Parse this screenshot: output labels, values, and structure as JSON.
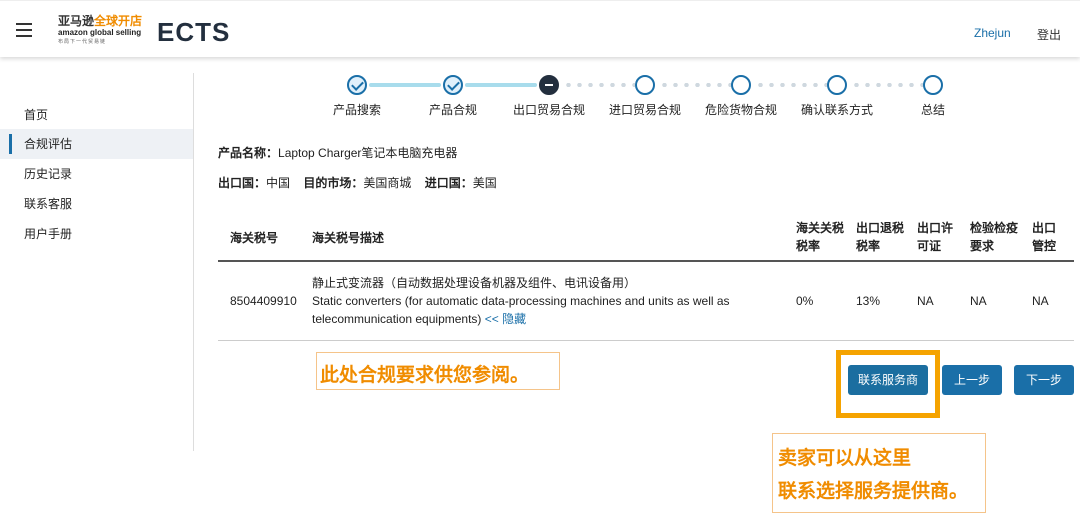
{
  "header": {
    "logo_line1_a": "亚马逊",
    "logo_line1_b": "全球开店",
    "logo_line2": "amazon global selling",
    "logo_line3": "布局下一代贸易链",
    "app_title": "ECTS",
    "user_name": "Zhejun",
    "logout_label": "登出"
  },
  "sidebar": {
    "items": [
      {
        "label": "首页",
        "active": false
      },
      {
        "label": "合规评估",
        "active": true
      },
      {
        "label": "历史记录",
        "active": false
      },
      {
        "label": "联系客服",
        "active": false
      },
      {
        "label": "用户手册",
        "active": false
      }
    ]
  },
  "stepper": {
    "steps": [
      {
        "label": "产品搜索",
        "state": "done"
      },
      {
        "label": "产品合规",
        "state": "done"
      },
      {
        "label": "出口贸易合规",
        "state": "current"
      },
      {
        "label": "进口贸易合规",
        "state": "pending"
      },
      {
        "label": "危险货物合规",
        "state": "pending"
      },
      {
        "label": "确认联系方式",
        "state": "pending"
      },
      {
        "label": "总结",
        "state": "pending"
      }
    ]
  },
  "product": {
    "name_label": "产品名称：",
    "name_value": "Laptop Charger笔记本电脑充电器",
    "export_label": "出口国：",
    "export_value": "中国",
    "target_label": "目的市场：",
    "target_value": "美国商城",
    "import_label": "进口国：",
    "import_value": "美国"
  },
  "table": {
    "headers": {
      "code": "海关税号",
      "desc": "海关税号描述",
      "tax_rate_1": "海关关税",
      "tax_rate_2": "税率",
      "rebate_1": "出口退税",
      "rebate_2": "税率",
      "license_1": "出口许",
      "license_2": "可证",
      "inspection_1": "检验检疫",
      "inspection_2": "要求",
      "control_1": "出口",
      "control_2": "管控"
    },
    "rows": [
      {
        "code": "8504409910",
        "desc_cn": "静止式变流器（自动数据处理设备机器及组件、电讯设备用）",
        "desc_en_1": "Static converters (for automatic data-processing machines and units as well as",
        "desc_en_2": "telecommunication equipments)",
        "hide_link": "<< 隐藏",
        "tax_rate": "0%",
        "rebate": "13%",
        "license": "NA",
        "inspection": "NA",
        "control": "NA"
      }
    ]
  },
  "annotations": {
    "note1": "此处合规要求供您参阅。",
    "note2_line1": "卖家可以从这里",
    "note2_line2": "联系选择服务提供商。"
  },
  "buttons": {
    "contact": "联系服务商",
    "prev": "上一步",
    "next": "下一步"
  },
  "colors": {
    "accent": "#1a6fa8",
    "highlight": "#f5a300",
    "annotation_text": "#f08c00"
  }
}
